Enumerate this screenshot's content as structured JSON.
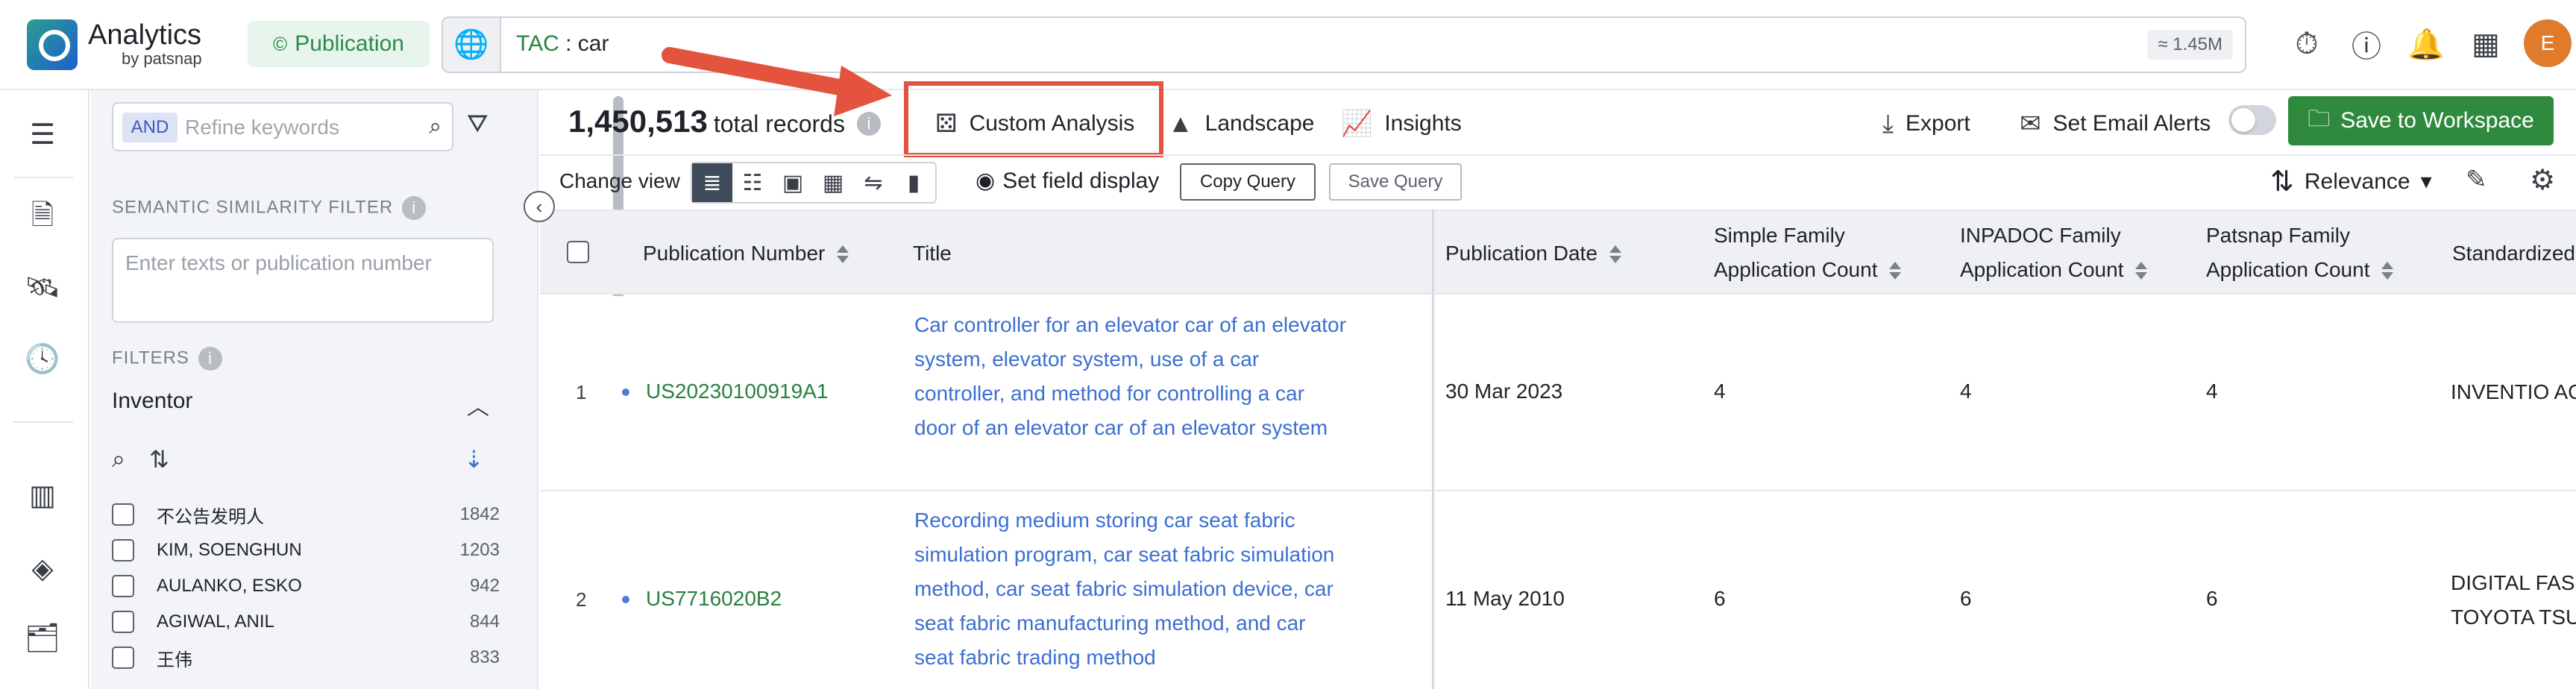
{
  "brand": {
    "title": "Analytics",
    "sub": "by patsnap"
  },
  "header": {
    "db_button": "Publication",
    "query": {
      "field": "TAC",
      "sep": " : ",
      "term": "car"
    },
    "count_chip": "≈ 1.45M",
    "avatar": "E"
  },
  "filters": {
    "and_label": "AND",
    "refine_placeholder": "Refine keywords",
    "semantic_label": "SEMANTIC SIMILARITY FILTER",
    "semantic_placeholder": "Enter texts or publication number",
    "filters_label": "FILTERS",
    "inventor_label": "Inventor",
    "inventors": [
      {
        "name": "不公告发明人",
        "count": "1842"
      },
      {
        "name": "KIM, SOENGHUN",
        "count": "1203"
      },
      {
        "name": "AULANKO, ESKO",
        "count": "942"
      },
      {
        "name": "AGIWAL, ANIL",
        "count": "844"
      },
      {
        "name": "王伟",
        "count": "833"
      }
    ]
  },
  "toolbar": {
    "records_count": "1,450,513",
    "records_suffix": "total records",
    "custom_analysis": "Custom Analysis",
    "landscape": "Landscape",
    "insights": "Insights",
    "export": "Export",
    "email_alerts": "Set Email Alerts",
    "save_workspace": "Save to Workspace",
    "change_view": "Change view",
    "set_field_display": "Set field display",
    "copy_query": "Copy Query",
    "save_query": "Save Query",
    "relevance": "Relevance"
  },
  "table": {
    "headers": {
      "pn": "Publication Number",
      "title": "Title",
      "date": "Publication Date",
      "simple_1": "Simple Family",
      "simple_2": "Application Count",
      "inpadoc_1": "INPADOC Family",
      "inpadoc_2": "Application Count",
      "patsnap_1": "Patsnap Family",
      "patsnap_2": "Application Count",
      "standardized": "Standardized"
    },
    "rows": [
      {
        "num": "1",
        "pn": "US20230100919A1",
        "title": "Car controller for an elevator car of an elevator system, elevator system, use of a car controller, and method for controlling a car door of an elevator car of an elevator system",
        "date": "30 Mar 2023",
        "simple": "4",
        "inpadoc": "4",
        "patsnap": "4",
        "std_1": "INVENTIO AG",
        "std_2": ""
      },
      {
        "num": "2",
        "pn": "US7716020B2",
        "title": "Recording medium storing car seat fabric simulation program, car seat fabric simulation method, car seat fabric simulation device, car seat fabric manufacturing method, and car seat fabric trading method",
        "date": "11 May 2010",
        "simple": "6",
        "inpadoc": "6",
        "patsnap": "6",
        "std_1": "DIGITAL FASHION",
        "std_2": "TOYOTA TSUSHO"
      }
    ]
  },
  "colors": {
    "accent": "#2f8a3e",
    "link": "#3b6fd1",
    "highlight": "#e4533d"
  }
}
